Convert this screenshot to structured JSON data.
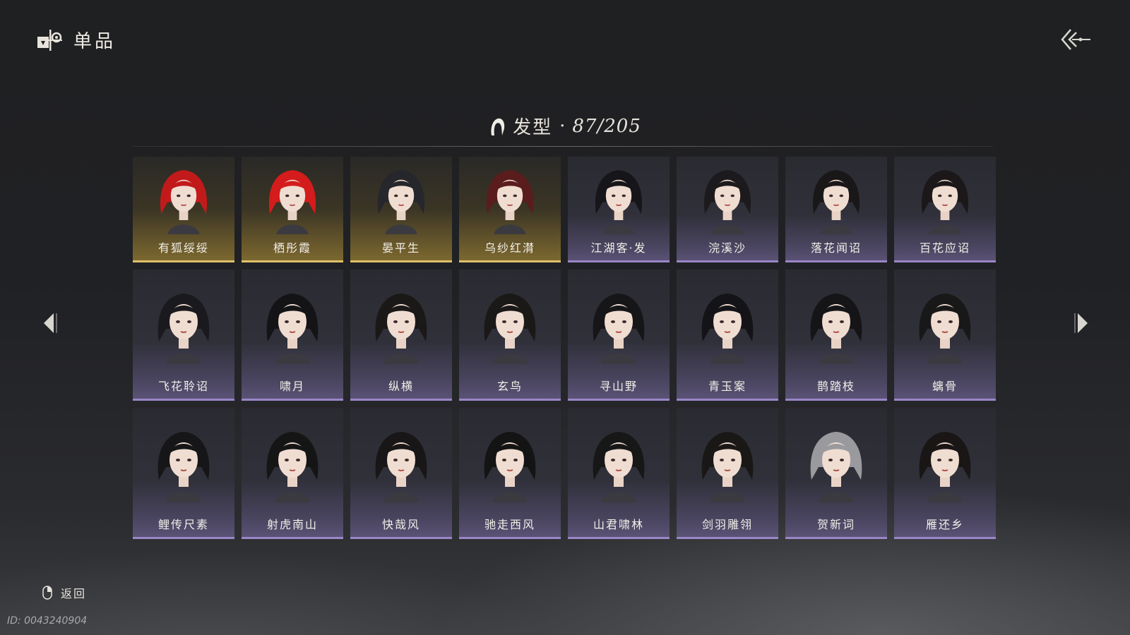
{
  "header": {
    "title": "单品",
    "logo_icon": "inventory-emblem-icon",
    "back_icon": "double-chevron-back-icon"
  },
  "category": {
    "icon": "hairstyle-icon",
    "label": "发型",
    "separator": "·",
    "count": "87/205"
  },
  "items": [
    {
      "name": "有狐绥绥",
      "rarity": "gold",
      "hair_color": "#c21a1a"
    },
    {
      "name": "栖彤霞",
      "rarity": "gold",
      "hair_color": "#d41c1c"
    },
    {
      "name": "晏平生",
      "rarity": "gold",
      "hair_color": "#26272c"
    },
    {
      "name": "乌纱红潸",
      "rarity": "gold",
      "hair_color": "#5a1c1c"
    },
    {
      "name": "江湖客·发",
      "rarity": "purple",
      "hair_color": "#16161a"
    },
    {
      "name": "浣溪沙",
      "rarity": "purple",
      "hair_color": "#1c1a1c"
    },
    {
      "name": "落花闻诏",
      "rarity": "purple",
      "hair_color": "#1a1718"
    },
    {
      "name": "百花应诏",
      "rarity": "purple",
      "hair_color": "#1c1819"
    },
    {
      "name": "飞花聆诏",
      "rarity": "purple",
      "hair_color": "#1a1a1e"
    },
    {
      "name": "啸月",
      "rarity": "purple",
      "hair_color": "#141416"
    },
    {
      "name": "纵横",
      "rarity": "purple",
      "hair_color": "#1b1818"
    },
    {
      "name": "玄鸟",
      "rarity": "purple",
      "hair_color": "#1b1818"
    },
    {
      "name": "寻山野",
      "rarity": "purple",
      "hair_color": "#161618"
    },
    {
      "name": "青玉案",
      "rarity": "purple",
      "hair_color": "#141418"
    },
    {
      "name": "鹊踏枝",
      "rarity": "purple",
      "hair_color": "#151518"
    },
    {
      "name": "螭骨",
      "rarity": "purple",
      "hair_color": "#181818"
    },
    {
      "name": "鲤传尺素",
      "rarity": "purple",
      "hair_color": "#161618"
    },
    {
      "name": "射虎南山",
      "rarity": "purple",
      "hair_color": "#151515"
    },
    {
      "name": "快哉风",
      "rarity": "purple",
      "hair_color": "#181616"
    },
    {
      "name": "驰走西风",
      "rarity": "purple",
      "hair_color": "#141414"
    },
    {
      "name": "山君啸林",
      "rarity": "purple",
      "hair_color": "#171717"
    },
    {
      "name": "剑羽雕翎",
      "rarity": "purple",
      "hair_color": "#1a1817"
    },
    {
      "name": "贺新词",
      "rarity": "purple",
      "hair_color": "#9a9a9e"
    },
    {
      "name": "雁还乡",
      "rarity": "purple",
      "hair_color": "#1a1616"
    }
  ],
  "navigation": {
    "prev_icon": "arrow-left-icon",
    "next_icon": "arrow-right-icon"
  },
  "footer": {
    "back_icon": "mouse-right-click-icon",
    "back_label": "返回",
    "uid": "ID: 0043240904"
  },
  "colors": {
    "gold_accent": "#e0c06a",
    "purple_accent": "#9a86c8"
  }
}
